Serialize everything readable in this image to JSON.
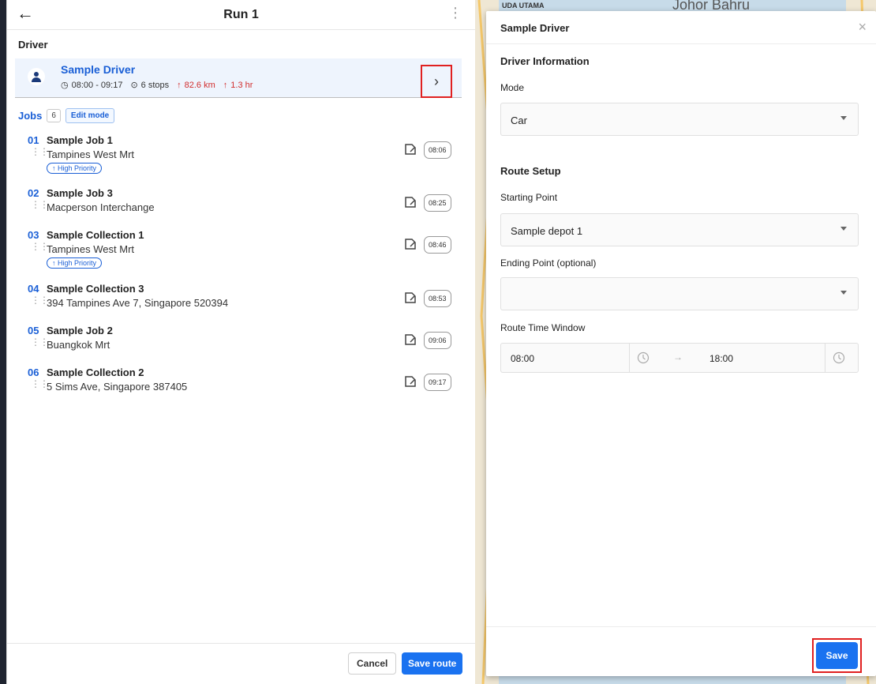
{
  "left": {
    "title": "Run 1",
    "driver_section_label": "Driver",
    "driver": {
      "name": "Sample Driver",
      "time_range": "08:00 - 09:17",
      "stops": "6 stops",
      "distance": "82.6 km",
      "duration": "1.3 hr"
    },
    "jobs_label": "Jobs",
    "jobs_count": "6",
    "edit_mode_label": "Edit mode",
    "jobs": [
      {
        "num": "01",
        "title": "Sample Job 1",
        "address": "Tampines West Mrt",
        "badge": "↑ High Priority",
        "time": "08:06"
      },
      {
        "num": "02",
        "title": "Sample Job 3",
        "address": "Macperson Interchange",
        "badge": "",
        "time": "08:25"
      },
      {
        "num": "03",
        "title": "Sample Collection 1",
        "address": "Tampines West Mrt",
        "badge": "↑ High Priority",
        "time": "08:46"
      },
      {
        "num": "04",
        "title": "Sample Collection 3",
        "address": "394 Tampines Ave 7, Singapore 520394",
        "badge": "",
        "time": "08:53"
      },
      {
        "num": "05",
        "title": "Sample Job 2",
        "address": "Buangkok Mrt",
        "badge": "",
        "time": "09:06"
      },
      {
        "num": "06",
        "title": "Sample Collection 2",
        "address": "5 Sims Ave, Singapore 387405",
        "badge": "",
        "time": "09:17"
      }
    ],
    "cancel_label": "Cancel",
    "save_route_label": "Save route"
  },
  "map": {
    "top_labels": [
      "UDA UTAMA",
      "Johor Bahru"
    ]
  },
  "modal": {
    "title": "Sample Driver",
    "driver_info_label": "Driver Information",
    "mode_label": "Mode",
    "mode_value": "Car",
    "route_setup_label": "Route Setup",
    "starting_point_label": "Starting Point",
    "starting_point_value": "Sample depot 1",
    "ending_point_label": "Ending Point (optional)",
    "ending_point_value": "",
    "time_window_label": "Route Time Window",
    "time_start": "08:00",
    "time_end": "18:00",
    "save_label": "Save"
  },
  "colors": {
    "accent": "#1a72f0",
    "link": "#1a5fd6",
    "highlight_box": "#e02020",
    "up_metric": "#d12e2e"
  }
}
